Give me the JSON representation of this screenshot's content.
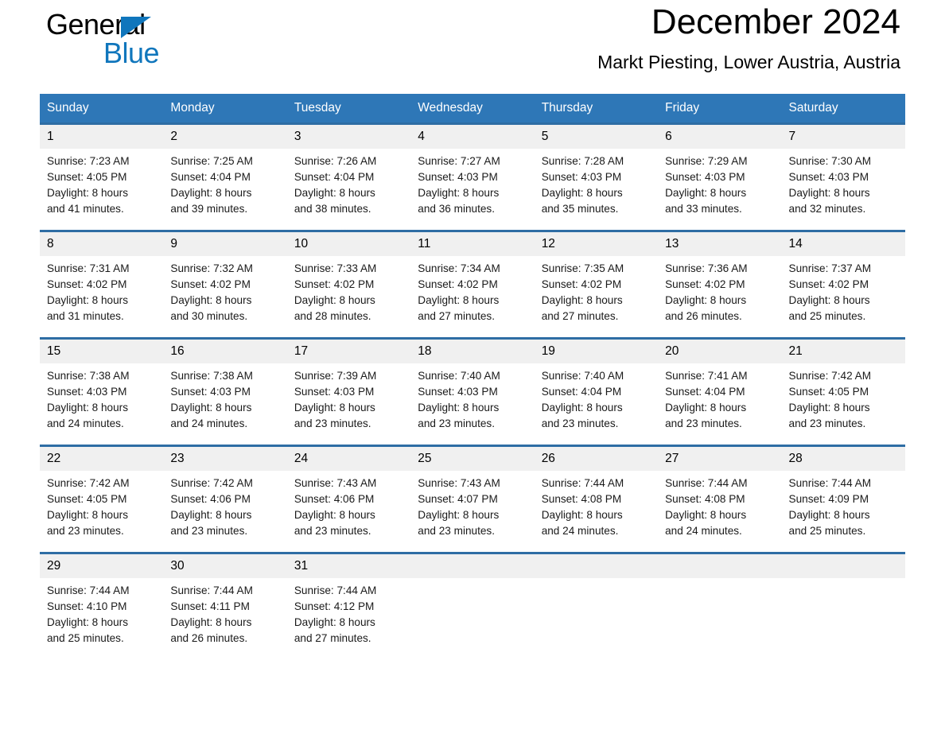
{
  "brand": {
    "word_one": "General",
    "word_two": "Blue",
    "triangle_icon": "triangle-icon",
    "accent_color": "#1076bc"
  },
  "header": {
    "month_title": "December 2024",
    "location": "Markt Piesting, Lower Austria, Austria"
  },
  "theme": {
    "header_blue": "#2e77b7",
    "row_border_blue": "#2e6da4",
    "daynum_band": "#f0f0f0"
  },
  "calendar": {
    "weekday_headers": [
      "Sunday",
      "Monday",
      "Tuesday",
      "Wednesday",
      "Thursday",
      "Friday",
      "Saturday"
    ],
    "weeks": [
      [
        {
          "day": "1",
          "info": "Sunrise: 7:23 AM\nSunset: 4:05 PM\nDaylight: 8 hours\nand 41 minutes."
        },
        {
          "day": "2",
          "info": "Sunrise: 7:25 AM\nSunset: 4:04 PM\nDaylight: 8 hours\nand 39 minutes."
        },
        {
          "day": "3",
          "info": "Sunrise: 7:26 AM\nSunset: 4:04 PM\nDaylight: 8 hours\nand 38 minutes."
        },
        {
          "day": "4",
          "info": "Sunrise: 7:27 AM\nSunset: 4:03 PM\nDaylight: 8 hours\nand 36 minutes."
        },
        {
          "day": "5",
          "info": "Sunrise: 7:28 AM\nSunset: 4:03 PM\nDaylight: 8 hours\nand 35 minutes."
        },
        {
          "day": "6",
          "info": "Sunrise: 7:29 AM\nSunset: 4:03 PM\nDaylight: 8 hours\nand 33 minutes."
        },
        {
          "day": "7",
          "info": "Sunrise: 7:30 AM\nSunset: 4:03 PM\nDaylight: 8 hours\nand 32 minutes."
        }
      ],
      [
        {
          "day": "8",
          "info": "Sunrise: 7:31 AM\nSunset: 4:02 PM\nDaylight: 8 hours\nand 31 minutes."
        },
        {
          "day": "9",
          "info": "Sunrise: 7:32 AM\nSunset: 4:02 PM\nDaylight: 8 hours\nand 30 minutes."
        },
        {
          "day": "10",
          "info": "Sunrise: 7:33 AM\nSunset: 4:02 PM\nDaylight: 8 hours\nand 28 minutes."
        },
        {
          "day": "11",
          "info": "Sunrise: 7:34 AM\nSunset: 4:02 PM\nDaylight: 8 hours\nand 27 minutes."
        },
        {
          "day": "12",
          "info": "Sunrise: 7:35 AM\nSunset: 4:02 PM\nDaylight: 8 hours\nand 27 minutes."
        },
        {
          "day": "13",
          "info": "Sunrise: 7:36 AM\nSunset: 4:02 PM\nDaylight: 8 hours\nand 26 minutes."
        },
        {
          "day": "14",
          "info": "Sunrise: 7:37 AM\nSunset: 4:02 PM\nDaylight: 8 hours\nand 25 minutes."
        }
      ],
      [
        {
          "day": "15",
          "info": "Sunrise: 7:38 AM\nSunset: 4:03 PM\nDaylight: 8 hours\nand 24 minutes."
        },
        {
          "day": "16",
          "info": "Sunrise: 7:38 AM\nSunset: 4:03 PM\nDaylight: 8 hours\nand 24 minutes."
        },
        {
          "day": "17",
          "info": "Sunrise: 7:39 AM\nSunset: 4:03 PM\nDaylight: 8 hours\nand 23 minutes."
        },
        {
          "day": "18",
          "info": "Sunrise: 7:40 AM\nSunset: 4:03 PM\nDaylight: 8 hours\nand 23 minutes."
        },
        {
          "day": "19",
          "info": "Sunrise: 7:40 AM\nSunset: 4:04 PM\nDaylight: 8 hours\nand 23 minutes."
        },
        {
          "day": "20",
          "info": "Sunrise: 7:41 AM\nSunset: 4:04 PM\nDaylight: 8 hours\nand 23 minutes."
        },
        {
          "day": "21",
          "info": "Sunrise: 7:42 AM\nSunset: 4:05 PM\nDaylight: 8 hours\nand 23 minutes."
        }
      ],
      [
        {
          "day": "22",
          "info": "Sunrise: 7:42 AM\nSunset: 4:05 PM\nDaylight: 8 hours\nand 23 minutes."
        },
        {
          "day": "23",
          "info": "Sunrise: 7:42 AM\nSunset: 4:06 PM\nDaylight: 8 hours\nand 23 minutes."
        },
        {
          "day": "24",
          "info": "Sunrise: 7:43 AM\nSunset: 4:06 PM\nDaylight: 8 hours\nand 23 minutes."
        },
        {
          "day": "25",
          "info": "Sunrise: 7:43 AM\nSunset: 4:07 PM\nDaylight: 8 hours\nand 23 minutes."
        },
        {
          "day": "26",
          "info": "Sunrise: 7:44 AM\nSunset: 4:08 PM\nDaylight: 8 hours\nand 24 minutes."
        },
        {
          "day": "27",
          "info": "Sunrise: 7:44 AM\nSunset: 4:08 PM\nDaylight: 8 hours\nand 24 minutes."
        },
        {
          "day": "28",
          "info": "Sunrise: 7:44 AM\nSunset: 4:09 PM\nDaylight: 8 hours\nand 25 minutes."
        }
      ],
      [
        {
          "day": "29",
          "info": "Sunrise: 7:44 AM\nSunset: 4:10 PM\nDaylight: 8 hours\nand 25 minutes."
        },
        {
          "day": "30",
          "info": "Sunrise: 7:44 AM\nSunset: 4:11 PM\nDaylight: 8 hours\nand 26 minutes."
        },
        {
          "day": "31",
          "info": "Sunrise: 7:44 AM\nSunset: 4:12 PM\nDaylight: 8 hours\nand 27 minutes."
        },
        {
          "day": "",
          "info": ""
        },
        {
          "day": "",
          "info": ""
        },
        {
          "day": "",
          "info": ""
        },
        {
          "day": "",
          "info": ""
        }
      ]
    ]
  }
}
